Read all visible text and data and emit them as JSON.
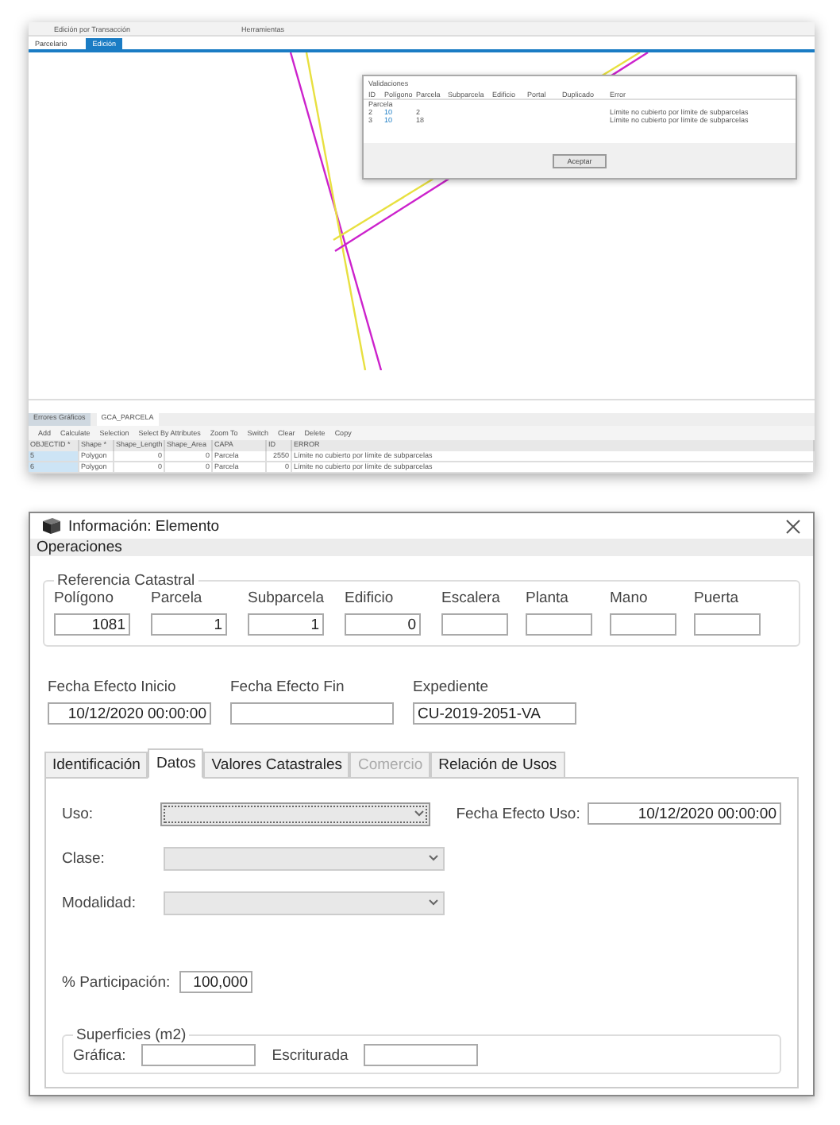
{
  "app_screenshot": {
    "menu": [
      "Edición por Transacción",
      "Herramientas"
    ],
    "tabs": [
      {
        "label": "Parcelario",
        "selected": false
      },
      {
        "label": "Edición",
        "selected": true
      }
    ],
    "validation_dialog": {
      "title": "Validaciones",
      "columns": [
        "ID",
        "Polígono",
        "Parcela",
        "Subparcela",
        "Edificio",
        "Portal",
        "Duplicado",
        "Error"
      ],
      "group": "Parcela",
      "rows": [
        {
          "id": "2",
          "poligono": "10",
          "parcela": "2",
          "error": "Límite no cubierto por límite de subparcelas"
        },
        {
          "id": "3",
          "poligono": "10",
          "parcela": "18",
          "error": "Límite no cubierto por límite de subparcelas"
        }
      ],
      "button": "Aceptar"
    },
    "table": {
      "tabs": [
        {
          "label": "Errores Gráficos",
          "selected": false
        },
        {
          "label": "GCA_PARCELA",
          "selected": true
        }
      ],
      "toolbar": [
        "Add",
        "Calculate",
        "Selection",
        "Select By Attributes",
        "Zoom To",
        "Switch",
        "Clear",
        "Delete",
        "Copy"
      ],
      "columns": [
        "OBJECTID *",
        "Shape *",
        "Shape_Length",
        "Shape_Area",
        "CAPA",
        "ID",
        "ERROR"
      ],
      "rows": [
        [
          "5",
          "Polygon",
          "0",
          "0",
          "Parcela",
          "2550",
          "Límite no cubierto por límite de subparcelas"
        ],
        [
          "6",
          "Polygon",
          "0",
          "0",
          "Parcela",
          "0",
          "Límite no cubierto por límite de subparcelas"
        ]
      ]
    }
  },
  "dialog": {
    "title": "Información: Elemento",
    "menu": [
      "Operaciones"
    ],
    "referencia": {
      "legend": "Referencia Catastral",
      "fields": [
        {
          "label": "Polígono",
          "value": "1081"
        },
        {
          "label": "Parcela",
          "value": "1"
        },
        {
          "label": "Subparcela",
          "value": "1"
        },
        {
          "label": "Edificio",
          "value": "0"
        },
        {
          "label": "Escalera"
        },
        {
          "label": "Planta"
        },
        {
          "label": "Mano"
        },
        {
          "label": "Puerta"
        }
      ]
    },
    "dates": [
      {
        "label": "Fecha Efecto Inicio",
        "value": "10/12/2020 00:00:00"
      },
      {
        "label": "Fecha Efecto Fin"
      },
      {
        "label": "Expediente",
        "value": "CU-2019-2051-VA"
      }
    ],
    "tabs": [
      {
        "label": "Identificación",
        "selected": false,
        "disabled": false
      },
      {
        "label": "Datos",
        "selected": true,
        "disabled": false
      },
      {
        "label": "Valores Catastrales",
        "selected": false,
        "disabled": false
      },
      {
        "label": "Comercio",
        "selected": false,
        "disabled": true
      },
      {
        "label": "Relación de Usos",
        "selected": false,
        "disabled": false
      }
    ],
    "selects": [
      {
        "label": "Uso:",
        "focused": true
      },
      {
        "label": "Clase:",
        "focused": false
      },
      {
        "label": "Modalidad:",
        "focused": false
      }
    ],
    "fecha_efecto_uso": {
      "label": "Fecha Efecto Uso:",
      "value": "10/12/2020 00:00:00"
    },
    "participacion": {
      "label": "% Participación:",
      "value": "100,000"
    },
    "superficies": {
      "legend": "Superficies (m2)",
      "fields": [
        {
          "label": "Gráfica:"
        },
        {
          "label": "Escriturada"
        }
      ]
    }
  }
}
